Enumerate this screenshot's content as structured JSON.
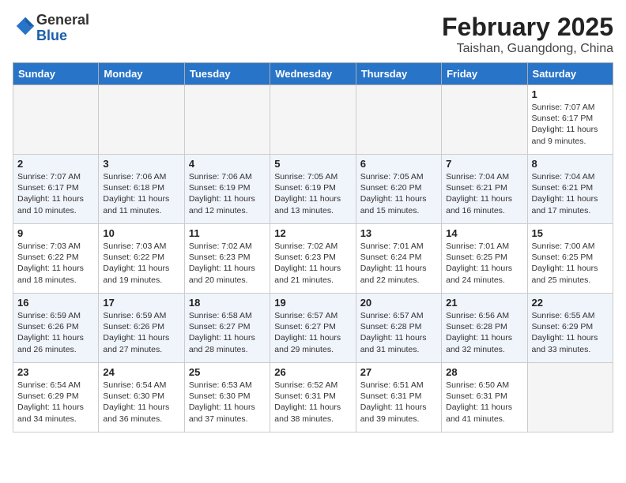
{
  "header": {
    "logo_general": "General",
    "logo_blue": "Blue",
    "month": "February 2025",
    "location": "Taishan, Guangdong, China"
  },
  "weekdays": [
    "Sunday",
    "Monday",
    "Tuesday",
    "Wednesday",
    "Thursday",
    "Friday",
    "Saturday"
  ],
  "weeks": [
    [
      {
        "day": "",
        "info": "",
        "empty": true
      },
      {
        "day": "",
        "info": "",
        "empty": true
      },
      {
        "day": "",
        "info": "",
        "empty": true
      },
      {
        "day": "",
        "info": "",
        "empty": true
      },
      {
        "day": "",
        "info": "",
        "empty": true
      },
      {
        "day": "",
        "info": "",
        "empty": true
      },
      {
        "day": "1",
        "info": "Sunrise: 7:07 AM\nSunset: 6:17 PM\nDaylight: 11 hours\nand 9 minutes.",
        "empty": false
      }
    ],
    [
      {
        "day": "2",
        "info": "Sunrise: 7:07 AM\nSunset: 6:17 PM\nDaylight: 11 hours\nand 10 minutes.",
        "empty": false
      },
      {
        "day": "3",
        "info": "Sunrise: 7:06 AM\nSunset: 6:18 PM\nDaylight: 11 hours\nand 11 minutes.",
        "empty": false
      },
      {
        "day": "4",
        "info": "Sunrise: 7:06 AM\nSunset: 6:19 PM\nDaylight: 11 hours\nand 12 minutes.",
        "empty": false
      },
      {
        "day": "5",
        "info": "Sunrise: 7:05 AM\nSunset: 6:19 PM\nDaylight: 11 hours\nand 13 minutes.",
        "empty": false
      },
      {
        "day": "6",
        "info": "Sunrise: 7:05 AM\nSunset: 6:20 PM\nDaylight: 11 hours\nand 15 minutes.",
        "empty": false
      },
      {
        "day": "7",
        "info": "Sunrise: 7:04 AM\nSunset: 6:21 PM\nDaylight: 11 hours\nand 16 minutes.",
        "empty": false
      },
      {
        "day": "8",
        "info": "Sunrise: 7:04 AM\nSunset: 6:21 PM\nDaylight: 11 hours\nand 17 minutes.",
        "empty": false
      }
    ],
    [
      {
        "day": "9",
        "info": "Sunrise: 7:03 AM\nSunset: 6:22 PM\nDaylight: 11 hours\nand 18 minutes.",
        "empty": false
      },
      {
        "day": "10",
        "info": "Sunrise: 7:03 AM\nSunset: 6:22 PM\nDaylight: 11 hours\nand 19 minutes.",
        "empty": false
      },
      {
        "day": "11",
        "info": "Sunrise: 7:02 AM\nSunset: 6:23 PM\nDaylight: 11 hours\nand 20 minutes.",
        "empty": false
      },
      {
        "day": "12",
        "info": "Sunrise: 7:02 AM\nSunset: 6:23 PM\nDaylight: 11 hours\nand 21 minutes.",
        "empty": false
      },
      {
        "day": "13",
        "info": "Sunrise: 7:01 AM\nSunset: 6:24 PM\nDaylight: 11 hours\nand 22 minutes.",
        "empty": false
      },
      {
        "day": "14",
        "info": "Sunrise: 7:01 AM\nSunset: 6:25 PM\nDaylight: 11 hours\nand 24 minutes.",
        "empty": false
      },
      {
        "day": "15",
        "info": "Sunrise: 7:00 AM\nSunset: 6:25 PM\nDaylight: 11 hours\nand 25 minutes.",
        "empty": false
      }
    ],
    [
      {
        "day": "16",
        "info": "Sunrise: 6:59 AM\nSunset: 6:26 PM\nDaylight: 11 hours\nand 26 minutes.",
        "empty": false
      },
      {
        "day": "17",
        "info": "Sunrise: 6:59 AM\nSunset: 6:26 PM\nDaylight: 11 hours\nand 27 minutes.",
        "empty": false
      },
      {
        "day": "18",
        "info": "Sunrise: 6:58 AM\nSunset: 6:27 PM\nDaylight: 11 hours\nand 28 minutes.",
        "empty": false
      },
      {
        "day": "19",
        "info": "Sunrise: 6:57 AM\nSunset: 6:27 PM\nDaylight: 11 hours\nand 29 minutes.",
        "empty": false
      },
      {
        "day": "20",
        "info": "Sunrise: 6:57 AM\nSunset: 6:28 PM\nDaylight: 11 hours\nand 31 minutes.",
        "empty": false
      },
      {
        "day": "21",
        "info": "Sunrise: 6:56 AM\nSunset: 6:28 PM\nDaylight: 11 hours\nand 32 minutes.",
        "empty": false
      },
      {
        "day": "22",
        "info": "Sunrise: 6:55 AM\nSunset: 6:29 PM\nDaylight: 11 hours\nand 33 minutes.",
        "empty": false
      }
    ],
    [
      {
        "day": "23",
        "info": "Sunrise: 6:54 AM\nSunset: 6:29 PM\nDaylight: 11 hours\nand 34 minutes.",
        "empty": false
      },
      {
        "day": "24",
        "info": "Sunrise: 6:54 AM\nSunset: 6:30 PM\nDaylight: 11 hours\nand 36 minutes.",
        "empty": false
      },
      {
        "day": "25",
        "info": "Sunrise: 6:53 AM\nSunset: 6:30 PM\nDaylight: 11 hours\nand 37 minutes.",
        "empty": false
      },
      {
        "day": "26",
        "info": "Sunrise: 6:52 AM\nSunset: 6:31 PM\nDaylight: 11 hours\nand 38 minutes.",
        "empty": false
      },
      {
        "day": "27",
        "info": "Sunrise: 6:51 AM\nSunset: 6:31 PM\nDaylight: 11 hours\nand 39 minutes.",
        "empty": false
      },
      {
        "day": "28",
        "info": "Sunrise: 6:50 AM\nSunset: 6:31 PM\nDaylight: 11 hours\nand 41 minutes.",
        "empty": false
      },
      {
        "day": "",
        "info": "",
        "empty": true
      }
    ]
  ]
}
